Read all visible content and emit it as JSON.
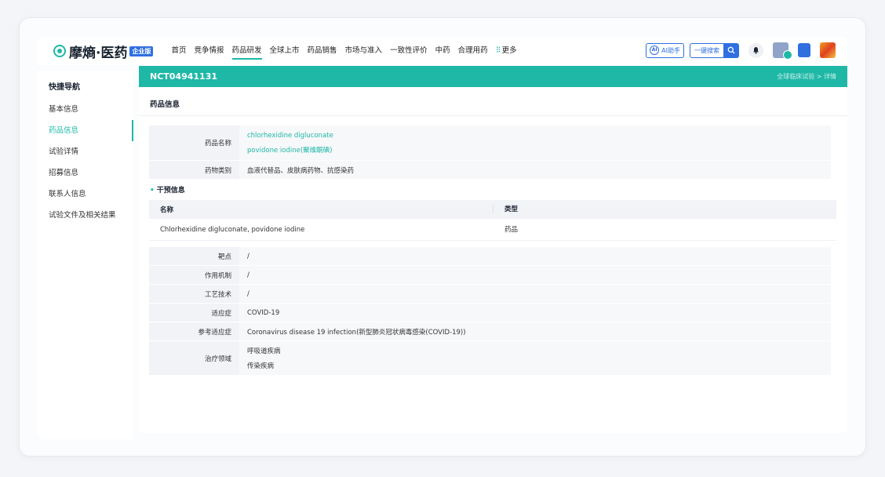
{
  "brand": {
    "name": "摩熵·医药",
    "edition": "企业版"
  },
  "nav": {
    "items": [
      "首页",
      "竞争情报",
      "药品研发",
      "全球上市",
      "药品销售",
      "市场与准入",
      "一致性评价",
      "中药",
      "合理用药"
    ],
    "active_index": 2,
    "more": "更多"
  },
  "header_tools": {
    "ai_label": "AI助手",
    "ai_badge": "AI",
    "search_label": "一键搜索"
  },
  "sidebar": {
    "title": "快捷导航",
    "items": [
      {
        "label": "基本信息"
      },
      {
        "label": "药品信息"
      },
      {
        "label": "试验详情"
      },
      {
        "label": "招募信息"
      },
      {
        "label": "联系人信息"
      },
      {
        "label": "试验文件及相关结果"
      }
    ],
    "active_index": 1
  },
  "page": {
    "trial_id": "NCT04941131",
    "breadcrumb": "全球临床试验 > 详情",
    "section_title": "药品信息"
  },
  "drug_info": {
    "name_label": "药品名称",
    "names": [
      "chlorhexidine digluconate",
      "povidone iodine(聚维酮碘)"
    ],
    "category_label": "药物类别",
    "category": "血液代替品、皮肤病药物、抗感染药"
  },
  "intervention": {
    "title": "干预信息",
    "headers": [
      "名称",
      "类型"
    ],
    "rows": [
      {
        "name": "Chlorhexidine digluconate, povidone iodine",
        "type": "药品"
      }
    ]
  },
  "details": {
    "target_label": "靶点",
    "target": "/",
    "mechanism_label": "作用机制",
    "mechanism": "/",
    "technology_label": "工艺技术",
    "technology": "/",
    "indication_label": "适应症",
    "indication": "COVID-19",
    "ref_indication_label": "参考适应症",
    "ref_indication": "Coronavirus disease 19 infection(新型肺炎冠状病毒感染(COVID-19))",
    "area_label": "治疗领域",
    "areas": [
      "呼吸道疾病",
      "传染疾病"
    ]
  },
  "colors": {
    "accent": "#1fb8a7",
    "brand_blue": "#2f6fe0"
  }
}
